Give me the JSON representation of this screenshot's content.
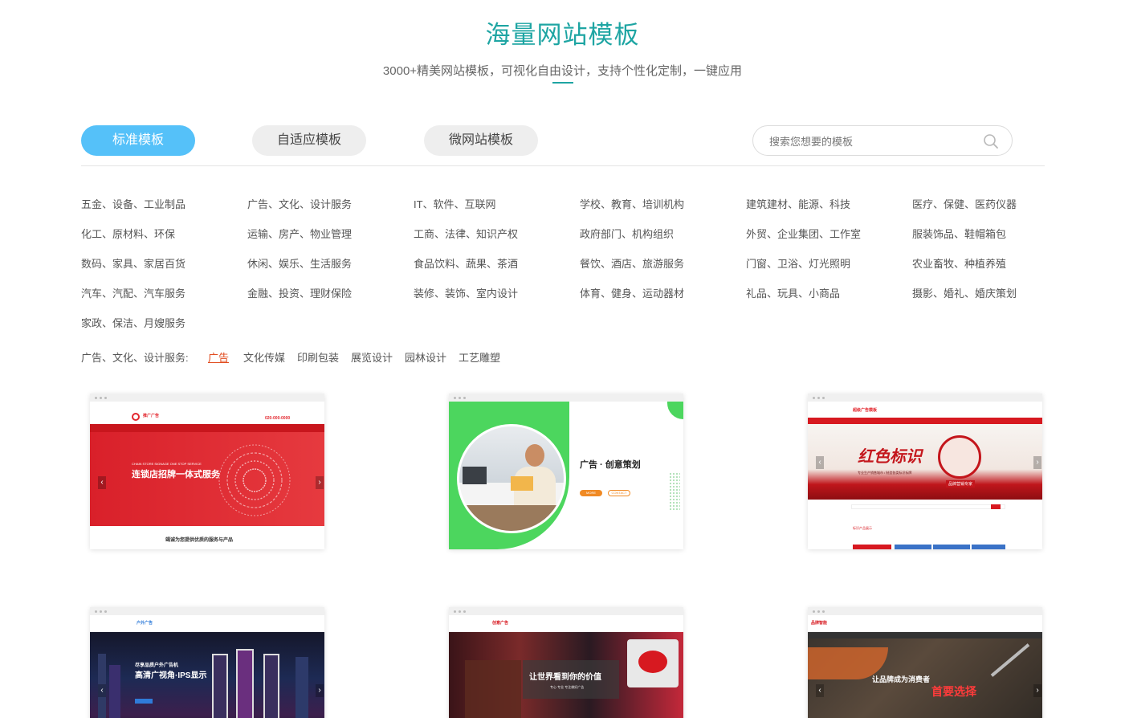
{
  "header": {
    "title": "海量网站模板",
    "subtitle": "3000+精美网站模板，可视化自由设计，支持个性化定制，一键应用"
  },
  "tabs": [
    {
      "label": "标准模板",
      "active": true
    },
    {
      "label": "自适应模板",
      "active": false
    },
    {
      "label": "微网站模板",
      "active": false
    }
  ],
  "search": {
    "placeholder": "搜索您想要的模板"
  },
  "categories": [
    [
      "五金、设备、工业制品",
      "广告、文化、设计服务",
      "IT、软件、互联网",
      "学校、教育、培训机构",
      "建筑建材、能源、科技",
      "医疗、保健、医药仪器"
    ],
    [
      "化工、原材料、环保",
      "运输、房产、物业管理",
      "工商、法律、知识产权",
      "政府部门、机构组织",
      "外贸、企业集团、工作室",
      "服装饰品、鞋帽箱包"
    ],
    [
      "数码、家具、家居百货",
      "休闲、娱乐、生活服务",
      "食品饮料、蔬果、茶酒",
      "餐饮、酒店、旅游服务",
      "门窗、卫浴、灯光照明",
      "农业畜牧、种植养殖"
    ],
    [
      "汽车、汽配、汽车服务",
      "金融、投资、理财保险",
      "装修、装饰、室内设计",
      "体育、健身、运动器材",
      "礼品、玩具、小商品",
      "摄影、婚礼、婚庆策划"
    ],
    [
      "家政、保洁、月嫂服务"
    ]
  ],
  "subcategory": {
    "label": "广告、文化、设计服务:",
    "items": [
      {
        "label": "广告",
        "active": true
      },
      {
        "label": "文化传媒",
        "active": false
      },
      {
        "label": "印刷包装",
        "active": false
      },
      {
        "label": "展览设计",
        "active": false
      },
      {
        "label": "园林设计",
        "active": false
      },
      {
        "label": "工艺雕塑",
        "active": false
      }
    ]
  },
  "templates": [
    {
      "banner_en": "CHAIN STORE SIGNAGE ONE STOP SERVICE",
      "headline": "连锁店招牌一体式服务",
      "footer": "竭诚为您提供优质的服务与产品",
      "logo": "推广广告",
      "phone": "020-000-0000"
    },
    {
      "headline": "广告 · 创意策划",
      "btn1": "MORE",
      "btn2": "CONTACT"
    },
    {
      "logo": "超级广告模板",
      "headline": "红色标识",
      "caption": "专业生产销售城市 / 制造各类标识标牌",
      "badge": "品牌营销专家",
      "section": "标识产品展示"
    },
    {
      "logo": "户外广告",
      "headline_small": "尽享品质户外广告机",
      "headline": "高清广视角·IPS显示"
    },
    {
      "logo": "创意广告",
      "headline": "让世界看到你的价值",
      "caption": "专心 专业 专注做好广告"
    },
    {
      "logo": "品牌智能",
      "headline_small": "让品牌成为消费者",
      "headline": "首要选择"
    }
  ],
  "colors": {
    "accent": "#1ea5a3",
    "tab_active": "#55c1f9",
    "subcat_active": "#e14c1f"
  }
}
